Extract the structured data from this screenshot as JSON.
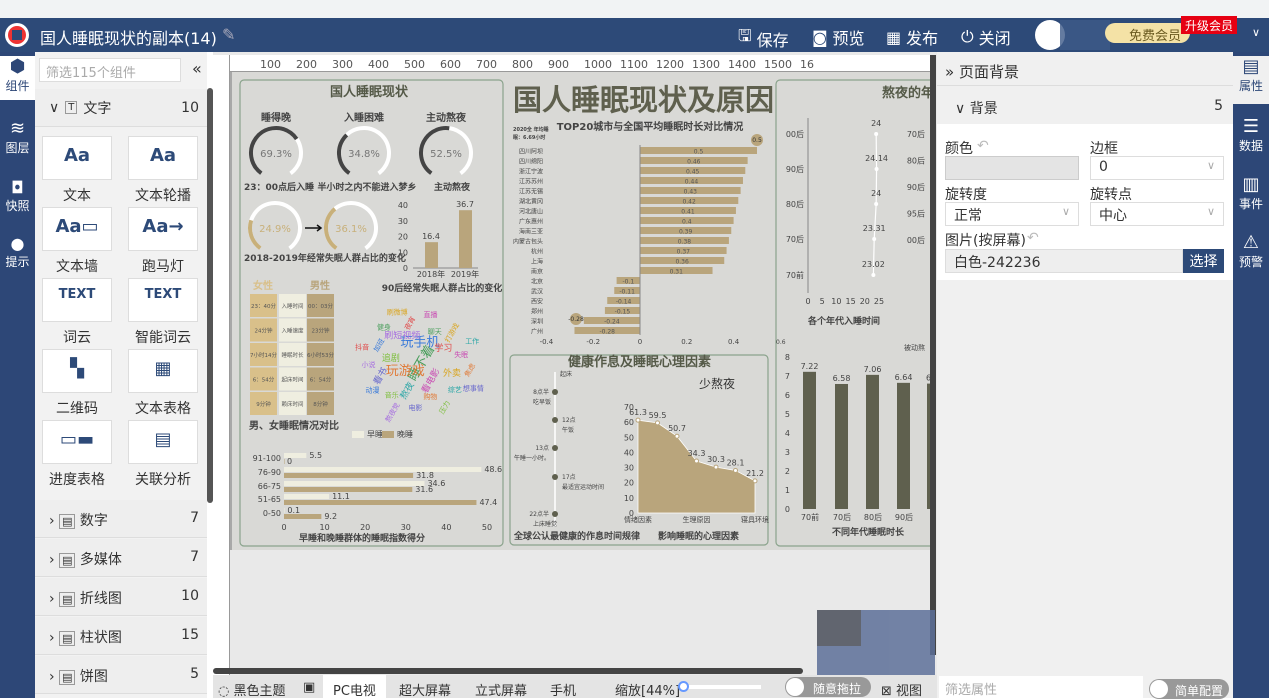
{
  "header": {
    "title": "国人睡眠现状的副本(14)",
    "save": "保存",
    "preview": "预览",
    "publish": "发布",
    "close": "关闭",
    "member_badge": "免费会员",
    "upgrade": "升级会员"
  },
  "rail": [
    {
      "label": "组件",
      "icon": "component-icon"
    },
    {
      "label": "图层",
      "icon": "layers-icon"
    },
    {
      "label": "快照",
      "icon": "camera-icon"
    },
    {
      "label": "提示",
      "icon": "bulb-icon"
    }
  ],
  "left_panel": {
    "search_placeholder": "筛选115个组件",
    "collapse": "«",
    "text_section": {
      "label": "文字",
      "count": "10",
      "items": [
        "文本",
        "文本轮播",
        "文本墙",
        "跑马灯",
        "词云",
        "智能词云",
        "二维码",
        "文本表格",
        "进度表格",
        "关联分析"
      ]
    },
    "sections": [
      {
        "label": "数字",
        "count": "7"
      },
      {
        "label": "多媒体",
        "count": "7"
      },
      {
        "label": "折线图",
        "count": "10"
      },
      {
        "label": "柱状图",
        "count": "15"
      },
      {
        "label": "饼图",
        "count": "5"
      }
    ]
  },
  "ruler": {
    "ticks": [
      "100",
      "200",
      "300",
      "400",
      "500",
      "600",
      "700",
      "800",
      "900",
      "1000",
      "1100",
      "1200",
      "1300",
      "1400",
      "1500",
      "16"
    ]
  },
  "canvas": {
    "main_title": "国人睡眠现状及原因",
    "panel1": {
      "title": "国人睡眠现状",
      "gauges": [
        {
          "label": "睡得晚",
          "value": 69.3,
          "text": "69.3%",
          "caption": "23：00点后入睡"
        },
        {
          "label": "入睡困难",
          "value": 34.8,
          "text": "34.8%",
          "caption": "半小时之内不能进入梦乡"
        },
        {
          "label": "主动熬夜",
          "value": 52.5,
          "text": "52.5%",
          "caption": "主动熬夜"
        }
      ],
      "change_gauges": [
        {
          "value": 24.9,
          "text": "24.9%"
        },
        {
          "value": 36.1,
          "text": "36.1%"
        }
      ],
      "change_caption": "2018-2019年经常失眠人群占比的变化",
      "bar90": {
        "type": "bar",
        "categories": [
          "2018年",
          "2019年"
        ],
        "values": [
          16.4,
          36.7
        ],
        "yticks": [
          "0",
          "10",
          "20",
          "30",
          "40"
        ],
        "ylim": [
          0,
          40
        ],
        "title": "90后经常失眠人群占比的变化"
      },
      "gender": {
        "female": "女性",
        "male": "男性",
        "rows": [
          [
            "23：40分",
            "入睡时间",
            "00：03分"
          ],
          [
            "24分钟",
            "入睡速度",
            "23分钟"
          ],
          [
            "7小时14分",
            "睡眠时长",
            "6小时53分"
          ],
          [
            "6：54分",
            "起床时间",
            "6：54分"
          ],
          [
            "9分钟",
            "赖床时间",
            "8分钟"
          ]
        ],
        "caption": "男、女睡眠情况对比"
      },
      "wordcloud": {
        "words": [
          "睡不着",
          "玩游戏",
          "玩手机",
          "看电影",
          "追剧",
          "学习",
          "熬夜",
          "刷短视频",
          "外卖",
          "看书",
          "聊天",
          "购物",
          "加班",
          "失眠",
          "音乐",
          "夜宵",
          "综艺",
          "小说",
          "打游戏",
          "电影",
          "健身",
          "焦虑",
          "动漫",
          "直播",
          "压力",
          "抖音",
          "工作",
          "熬夜党",
          "刷微博",
          "想事情"
        ]
      },
      "score": {
        "type": "bar",
        "orientation": "horizontal",
        "categories": [
          "91-100",
          "76-90",
          "66-75",
          "51-65",
          "0-50"
        ],
        "series": [
          {
            "name": "早睡",
            "values": [
              5.5,
              48.6,
              34.6,
              11.1,
              0.1
            ],
            "color": "#efeee0"
          },
          {
            "name": "晚睡",
            "values": [
              0,
              31.8,
              31.6,
              47.4,
              9.2
            ],
            "color": "#b9a57c"
          }
        ],
        "xticks": [
          "0",
          "10",
          "20",
          "30",
          "40",
          "50"
        ],
        "xlim": [
          0,
          50
        ],
        "title": "早睡和晚睡群体的睡眠指数得分"
      }
    },
    "top20": {
      "type": "bar",
      "orientation": "horizontal",
      "title": "TOP20城市与全国平均睡眠时长对比情况",
      "note": [
        "2020全 年均睡",
        "眠：6.69小时"
      ],
      "categories": [
        "四川阿坝",
        "四川绵阳",
        "浙江宁波",
        "江苏苏州",
        "江苏无锡",
        "湖北黄冈",
        "河北唐山",
        "广东惠州",
        "海南三亚",
        "内蒙古包头",
        "杭州",
        "上海",
        "南京",
        "北京",
        "武汉",
        "西安",
        "郑州",
        "深圳",
        "广州"
      ],
      "values": [
        0.5,
        0.46,
        0.45,
        0.44,
        0.43,
        0.42,
        0.41,
        0.4,
        0.39,
        0.38,
        0.37,
        0.36,
        0.31,
        -0.1,
        -0.11,
        -0.14,
        -0.15,
        -0.24,
        -0.28
      ],
      "xticks": [
        "-0.4",
        "-0.2",
        "0",
        "0.2",
        "0.4"
      ],
      "xlim": [
        -0.4,
        0.5
      ],
      "max_marker": "0.5",
      "min_marker": "-0.28",
      "color": "#b9a57c"
    },
    "health": {
      "title": "健康作息及睡眠心理因素",
      "timeline": [
        {
          "t": "",
          "d": "起床"
        },
        {
          "t": "8点半",
          "d": "吃早饭"
        },
        {
          "t": "12点",
          "d": "午饭"
        },
        {
          "t": "13点",
          "d": "午睡一小时。"
        },
        {
          "t": "17点",
          "d": "最适宜运动时间"
        },
        {
          "t": "22点半",
          "d": "上床睡觉"
        }
      ],
      "timeline_caption": "全球公认最健康的作息时间规律",
      "area": {
        "type": "area",
        "title": "少熬夜",
        "categories": [
          "情绪因素",
          "",
          "",
          "生理原因",
          "",
          "",
          "寝具环境"
        ],
        "values": [
          61.3,
          59.5,
          50.7,
          34.3,
          30.3,
          28.1,
          21.2
        ],
        "yticks": [
          "0",
          "10",
          "20",
          "30",
          "40",
          "50",
          "60",
          "70"
        ],
        "ylim": [
          0,
          70
        ],
        "color": "#b9a57c"
      },
      "area_caption": "影响睡眠的心理因素"
    },
    "panel3": {
      "title": "熬夜的年",
      "sleep_time": {
        "type": "line",
        "categories": [
          "00后",
          "90后",
          "80后",
          "70后",
          "70前"
        ],
        "values": [
          24,
          24.14,
          24,
          23.31,
          23.02
        ],
        "xticks": [
          "0",
          "5",
          "10",
          "15",
          "20",
          "25"
        ],
        "xlim": [
          0,
          25
        ],
        "title": "各个年代入睡时间"
      },
      "clipped_axis": [
        "70后",
        "80后",
        "90后",
        "95后",
        "00后"
      ],
      "duration": {
        "type": "bar",
        "categories": [
          "70前",
          "70后",
          "80后",
          "90后"
        ],
        "values": [
          7.22,
          6.58,
          7.06,
          6.64
        ],
        "yticks": [
          "0",
          "1",
          "2",
          "3",
          "4",
          "5",
          "6",
          "7",
          "8"
        ],
        "ylim": [
          0,
          8
        ],
        "title": "不同年代睡眠时长",
        "extra_label": "0.6",
        "side_label": "被动熬",
        "clipped_value": "6",
        "color": "#5f604e"
      }
    }
  },
  "right_panel": {
    "title": "页面背景",
    "section": "背景",
    "count": "5",
    "color_label": "颜色",
    "border_label": "边框",
    "border_value": "0",
    "rotate_label": "旋转度",
    "rotate_value": "正常",
    "pivot_label": "旋转点",
    "pivot_value": "中心",
    "image_label": "图片(按屏幕)",
    "image_value": "白色-242236",
    "choose": "选择",
    "filter_placeholder": "筛选属性",
    "simple_config": "简单配置"
  },
  "right_rail": [
    "属性",
    "数据",
    "事件",
    "预警"
  ],
  "bottom": {
    "theme": "黑色主题",
    "tabs": [
      "PC电视",
      "超大屏幕",
      "立式屏幕",
      "手机"
    ],
    "zoom": "缩放[44%]",
    "zoom_value": 44,
    "free_drag": "随意拖拉",
    "view": "视图"
  },
  "colors": {
    "header": "#2d4a78",
    "accent_tan": "#b9a57c",
    "dark_bar": "#5f604e",
    "upgrade": "#e60012"
  }
}
